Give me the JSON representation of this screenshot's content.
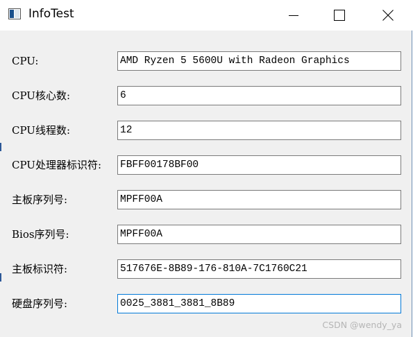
{
  "window": {
    "title": "InfoTest",
    "icon": "application-window-icon"
  },
  "caption_buttons": {
    "minimize_icon": "minimize-icon",
    "maximize_icon": "maximize-icon",
    "close_icon": "close-icon"
  },
  "fields": [
    {
      "label": "CPU:",
      "value": "AMD Ryzen 5 5600U with Radeon Graphics"
    },
    {
      "label": "CPU核心数:",
      "value": "6"
    },
    {
      "label": "CPU线程数:",
      "value": "12"
    },
    {
      "label": "CPU处理器标识符:",
      "value": "FBFF00178BF00"
    },
    {
      "label": "主板序列号:",
      "value": "MPFF00A"
    },
    {
      "label": "Bios序列号:",
      "value": "MPFF00A"
    },
    {
      "label": "主板标识符:",
      "value": "517676E-8B89-176-810A-7C1760C21"
    },
    {
      "label": "硬盘序列号:",
      "value": "0025_3881_3881_8B89"
    }
  ],
  "focused_field": "硬盘序列号:",
  "watermark": "CSDN @wendy_ya",
  "colors": {
    "window_bg": "#f0f0f0",
    "titlebar_bg": "#ffffff",
    "field_border": "#7a7a7a",
    "focus_border": "#0078d7",
    "accent_icon": "#1a4f8b"
  }
}
